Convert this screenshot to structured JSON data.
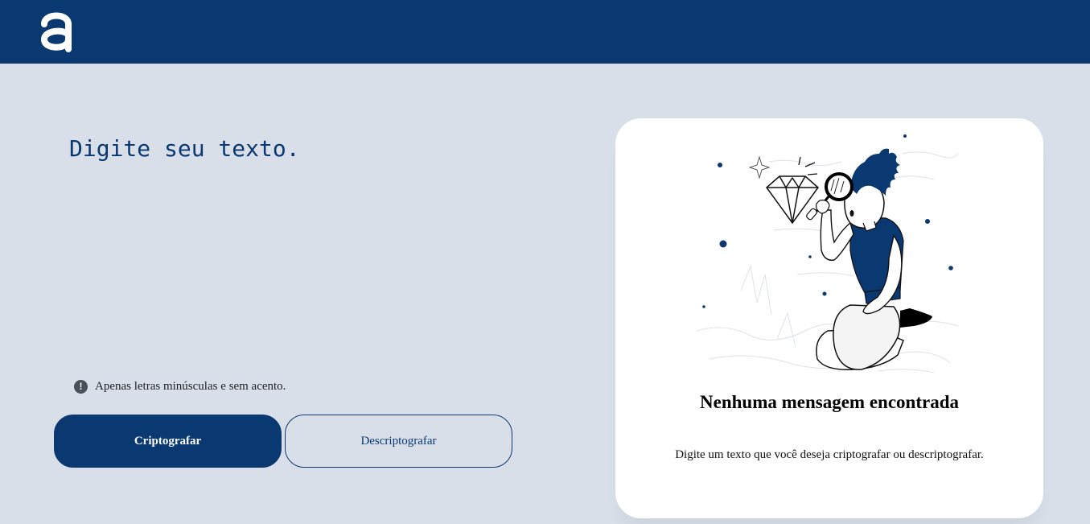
{
  "header": {
    "logo_icon": "alura-a-logo-icon",
    "background": "#0a3871"
  },
  "input": {
    "placeholder": "Digite seu texto."
  },
  "hint": {
    "icon": "exclamation-circle-icon",
    "text": "Apenas letras minúsculas e sem acento."
  },
  "buttons": {
    "encrypt_label": "Criptografar",
    "decrypt_label": "Descriptografar"
  },
  "output": {
    "illustration": "person-with-magnifying-glass-illustration",
    "title": "Nenhuma mensagem encontrada",
    "text": "Digite um texto que você deseja criptografar ou descriptografar."
  },
  "colors": {
    "accent": "#0a3871",
    "background": "#d8dfe9",
    "card": "#ffffff"
  }
}
